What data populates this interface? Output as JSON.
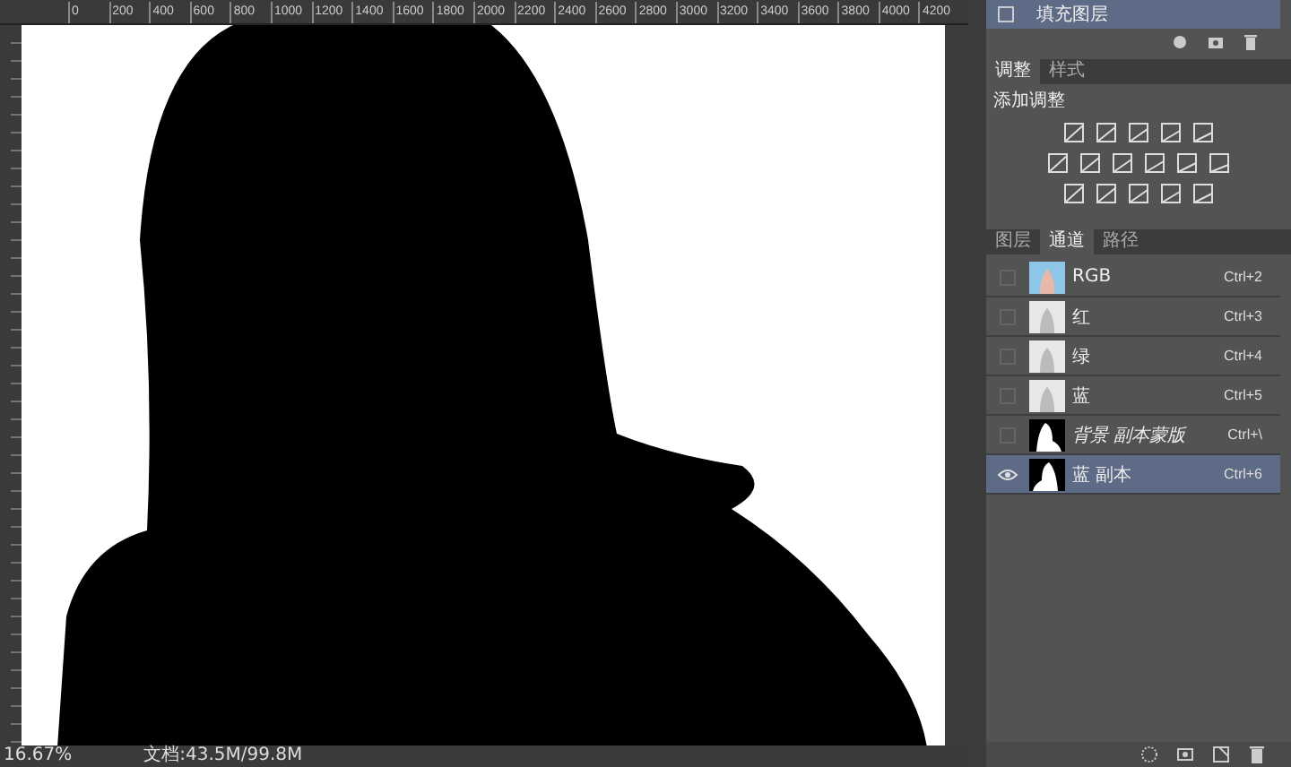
{
  "rulers": {
    "top_labels": [
      "0",
      "200",
      "400",
      "600",
      "800",
      "1000",
      "1200",
      "1400",
      "1600",
      "1800",
      "2000",
      "2200",
      "2400",
      "2600",
      "2800",
      "3000",
      "3200",
      "3400",
      "3600",
      "3800",
      "4000",
      "4200"
    ]
  },
  "status_bar": {
    "zoom": "16.67%",
    "document": "文档:43.5M/99.8M"
  },
  "layers_panel": {
    "layer": {
      "name": "填充图层",
      "selected": true
    }
  },
  "adjustments_panel": {
    "tabs": [
      {
        "label": "调整",
        "selected": true
      },
      {
        "label": "样式",
        "selected": false
      }
    ],
    "heading": "添加调整"
  },
  "channels_panel": {
    "tabs": [
      {
        "label": "图层",
        "selected": false
      },
      {
        "label": "通道",
        "selected": true
      },
      {
        "label": "路径",
        "selected": false
      }
    ],
    "channels": [
      {
        "name": "RGB",
        "shortcut": "Ctrl+2",
        "kind": "composite",
        "visible": false,
        "selected": false
      },
      {
        "name": "红",
        "shortcut": "Ctrl+3",
        "kind": "color",
        "visible": false,
        "selected": false
      },
      {
        "name": "绿",
        "shortcut": "Ctrl+4",
        "kind": "color",
        "visible": false,
        "selected": false
      },
      {
        "name": "蓝",
        "shortcut": "Ctrl+5",
        "kind": "color",
        "visible": false,
        "selected": false
      },
      {
        "name": "背景 副本蒙版",
        "shortcut": "Ctrl+\\",
        "kind": "mask",
        "visible": false,
        "selected": false
      },
      {
        "name": "蓝 副本",
        "shortcut": "Ctrl+6",
        "kind": "alpha",
        "visible": true,
        "selected": true
      }
    ]
  }
}
